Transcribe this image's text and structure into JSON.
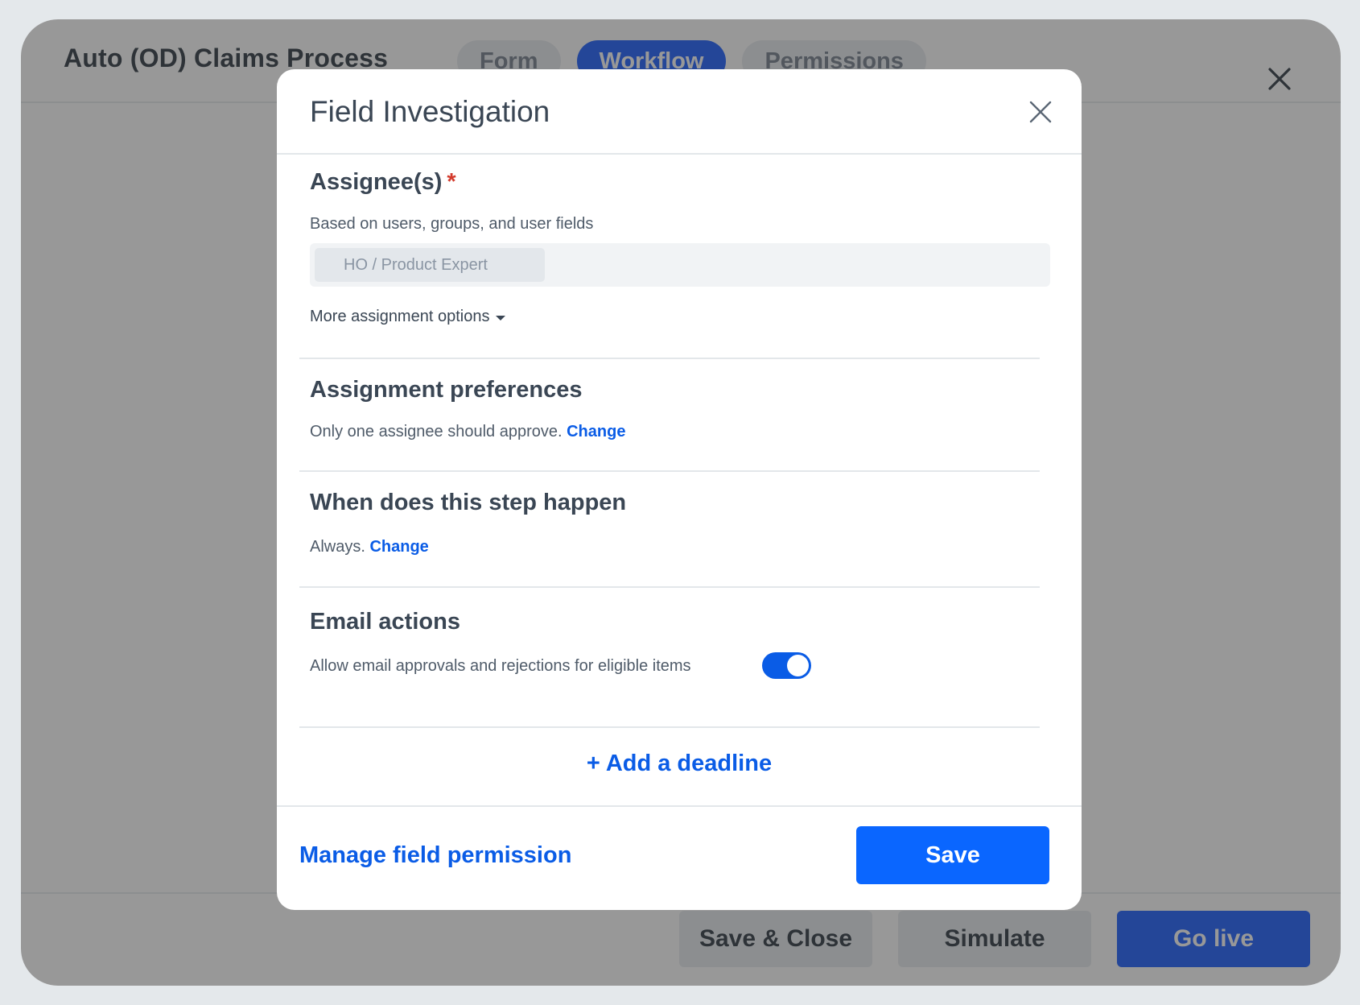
{
  "app": {
    "title": "Auto (OD) Claims Process",
    "tabs": [
      {
        "label": "Form",
        "active": false
      },
      {
        "label": "Workflow",
        "active": true
      },
      {
        "label": "Permissions",
        "active": false
      }
    ],
    "close_icon": "close-icon",
    "footer": {
      "save_close_label": "Save & Close",
      "simulate_label": "Simulate",
      "go_live_label": "Go live"
    }
  },
  "modal": {
    "title": "Field Investigation",
    "close_icon": "close-icon",
    "assignees": {
      "title": "Assignee(s)",
      "required_marker": "*",
      "subtitle": "Based on users, groups, and user fields",
      "selected": "HO / Product Expert",
      "more_options_label": "More assignment options"
    },
    "assignment_preferences": {
      "title": "Assignment preferences",
      "text": "Only one assignee should approve.",
      "link": "Change"
    },
    "step_timing": {
      "title": "When does this step happen",
      "text": "Always.",
      "link": "Change"
    },
    "email_actions": {
      "title": "Email actions",
      "text": "Allow email approvals and rejections for eligible items",
      "toggle_on": true
    },
    "add_deadline_label": "+ Add a deadline",
    "footer": {
      "manage_permission_label": "Manage field permission",
      "save_label": "Save"
    }
  },
  "colors": {
    "primary": "#0a66ff",
    "link": "#0a5ce6",
    "required": "#d33a2c",
    "overlay": "#999999"
  }
}
